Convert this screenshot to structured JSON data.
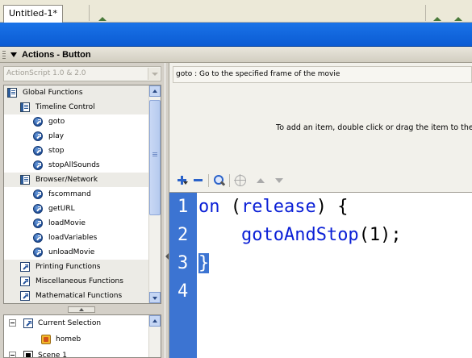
{
  "document_tab": {
    "title": "Untitled-1*"
  },
  "panel": {
    "title": "Actions - Button"
  },
  "toolbox": {
    "version_select": "ActionScript 1.0 & 2.0",
    "rows": [
      {
        "label": "Global Functions",
        "kind": "book",
        "level": 0,
        "category": true
      },
      {
        "label": "Timeline Control",
        "kind": "book",
        "level": 1,
        "category": true
      },
      {
        "label": "goto",
        "kind": "fn",
        "level": 2,
        "category": false
      },
      {
        "label": "play",
        "kind": "fn",
        "level": 2,
        "category": false
      },
      {
        "label": "stop",
        "kind": "fn",
        "level": 2,
        "category": false
      },
      {
        "label": "stopAllSounds",
        "kind": "fn",
        "level": 2,
        "category": false
      },
      {
        "label": "Browser/Network",
        "kind": "book",
        "level": 1,
        "category": true
      },
      {
        "label": "fscommand",
        "kind": "fn",
        "level": 2,
        "category": false
      },
      {
        "label": "getURL",
        "kind": "fn",
        "level": 2,
        "category": false
      },
      {
        "label": "loadMovie",
        "kind": "fn",
        "level": 2,
        "category": false
      },
      {
        "label": "loadVariables",
        "kind": "fn",
        "level": 2,
        "category": false
      },
      {
        "label": "unloadMovie",
        "kind": "fn",
        "level": 2,
        "category": false
      },
      {
        "label": "Printing Functions",
        "kind": "box",
        "level": 1,
        "category": true
      },
      {
        "label": "Miscellaneous Functions",
        "kind": "box",
        "level": 1,
        "category": true
      },
      {
        "label": "Mathematical Functions",
        "kind": "box",
        "level": 1,
        "category": true
      }
    ]
  },
  "script_navigator": {
    "items": [
      {
        "label": "Current Selection",
        "icon": "box-icon",
        "level": 0,
        "expander": true
      },
      {
        "label": "homeb",
        "icon": "button-symbol-icon",
        "level": 1,
        "expander": false
      },
      {
        "label": "Scene 1",
        "icon": "scene-icon",
        "level": 0,
        "expander": true
      }
    ]
  },
  "help": {
    "text": "goto : Go to the specified frame of the movie",
    "hint": "To add an item, double click or drag the item to the"
  },
  "editor": {
    "line_numbers": [
      "1",
      "2",
      "3",
      "4"
    ],
    "lines": [
      {
        "tokens": [
          {
            "t": "on",
            "c": "kw"
          },
          {
            "t": " (",
            "c": "plain"
          },
          {
            "t": "release",
            "c": "kw"
          },
          {
            "t": ") {",
            "c": "plain"
          }
        ]
      },
      {
        "tokens": [
          {
            "t": "    ",
            "c": "plain"
          },
          {
            "t": "gotoAndStop",
            "c": "kw"
          },
          {
            "t": "(1);",
            "c": "plain"
          }
        ]
      },
      {
        "tokens": [
          {
            "t": "}",
            "c": "cursor-sel"
          }
        ]
      },
      {
        "tokens": []
      }
    ]
  },
  "colors": {
    "gutter": "#3c74d2",
    "keyword": "#0a1fd6",
    "timeline_band": "#0b5bd3"
  }
}
